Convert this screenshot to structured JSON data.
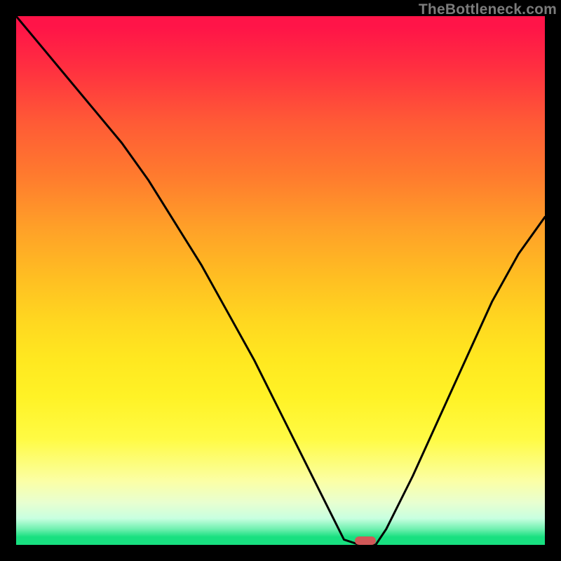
{
  "watermark_text": "TheBottleneck.com",
  "chart_data": {
    "type": "line",
    "title": "",
    "xlabel": "",
    "ylabel": "",
    "xlim": [
      0,
      100
    ],
    "ylim": [
      0,
      100
    ],
    "x": [
      0,
      5,
      10,
      15,
      20,
      25,
      30,
      35,
      40,
      45,
      50,
      55,
      60,
      62,
      65,
      68,
      70,
      75,
      80,
      85,
      90,
      95,
      100
    ],
    "values": [
      100,
      94,
      88,
      82,
      76,
      69,
      61,
      53,
      44,
      35,
      25,
      15,
      5,
      1,
      0,
      0,
      3,
      13,
      24,
      35,
      46,
      55,
      62
    ],
    "optimum_x": 66,
    "optimum_width": 4,
    "gradient_stops": [
      {
        "pos": 0,
        "color": "#ff1448"
      },
      {
        "pos": 50,
        "color": "#ffc022"
      },
      {
        "pos": 80,
        "color": "#fffb44"
      },
      {
        "pos": 100,
        "color": "#18e080"
      }
    ]
  }
}
